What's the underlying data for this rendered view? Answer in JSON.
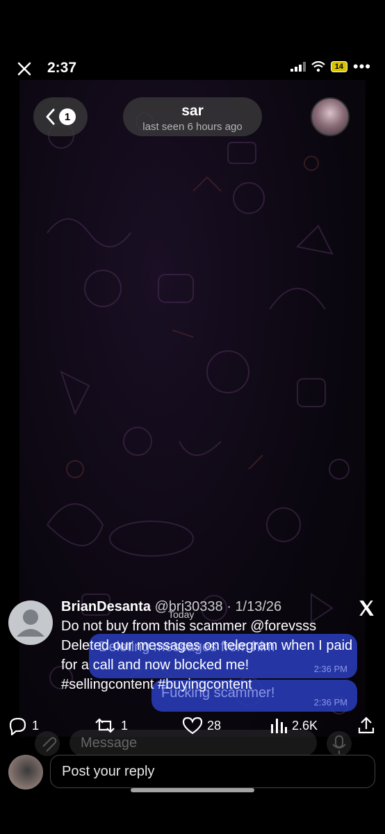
{
  "status": {
    "time": "2:37",
    "battery": "14"
  },
  "chat": {
    "back_count": "1",
    "contact_name": "sar",
    "last_seen": "last seen 6 hours ago",
    "date_divider": "Today",
    "messages": [
      {
        "text": "Deleting messages from him",
        "time": "2:36 PM",
        "emoji": "😂😂"
      },
      {
        "text": "Fucking scammer!",
        "time": "2:36 PM"
      }
    ],
    "composer_placeholder": "Message"
  },
  "tweet": {
    "display_name": "BrianDesanta",
    "handle": "@bri30338",
    "date": "1/13/26",
    "lines": [
      "Do not buy from this scammer @forevsss",
      "Deleted our messages on telegram when I paid",
      "for a call and now blocked me!",
      "#sellingcontent #buyingcontent"
    ],
    "replies": "1",
    "reposts": "1",
    "likes": "28",
    "views": "2.6K"
  },
  "reply": {
    "placeholder": "Post your reply"
  }
}
